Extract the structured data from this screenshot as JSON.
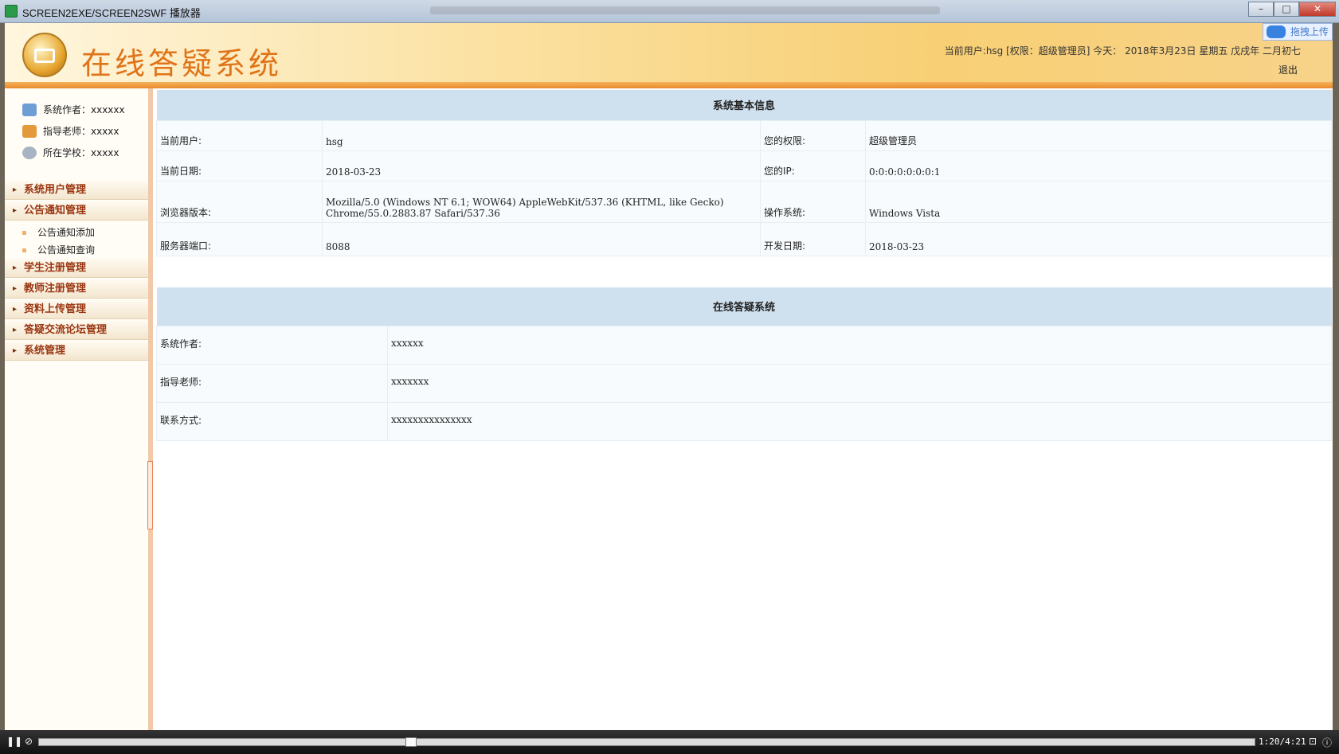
{
  "window": {
    "title": "SCREEN2EXE/SCREEN2SWF 播放器",
    "min": "–",
    "max": "□",
    "close": "✕"
  },
  "header": {
    "site_title": "在线答疑系统",
    "user_info": "当前用户:hsg [权限：超级管理员] 今天： 2018年3月23日 星期五 戊戌年 二月初七",
    "logout": "退出",
    "upload": "拖拽上传"
  },
  "sidebar": {
    "info": [
      {
        "label": "系统作者：xxxxxx"
      },
      {
        "label": "指导老师：xxxxx"
      },
      {
        "label": "所在学校：xxxxx"
      }
    ],
    "menus": [
      {
        "label": "系统用户管理"
      },
      {
        "label": "公告通知管理"
      },
      {
        "label": "学生注册管理"
      },
      {
        "label": "教师注册管理"
      },
      {
        "label": "资料上传管理"
      },
      {
        "label": "答疑交流论坛管理"
      },
      {
        "label": "系统管理"
      }
    ],
    "sub_items": [
      {
        "label": "公告通知添加"
      },
      {
        "label": "公告通知查询"
      }
    ]
  },
  "sysinfo": {
    "title": "系统基本信息",
    "rows": [
      {
        "l1": "当前用户:",
        "v1": "hsg",
        "l2": "您的权限:",
        "v2": "超级管理员"
      },
      {
        "l1": "当前日期:",
        "v1": "2018-03-23",
        "l2": "您的IP:",
        "v2": "0:0:0:0:0:0:0:1"
      },
      {
        "l1": "浏览器版本:",
        "v1a": "Mozilla/5.0 (Windows NT 6.1; WOW64) AppleWebKit/537.36 (KHTML, like Gecko)",
        "v1b": "Chrome/55.0.2883.87 Safari/537.36",
        "l2": "操作系统:",
        "v2": "Windows Vista"
      },
      {
        "l1": "服务器端口:",
        "v1": "8088",
        "l2": "开发日期:",
        "v2": "2018-03-23"
      }
    ]
  },
  "about": {
    "title": "在线答疑系统",
    "rows": [
      {
        "label": "系统作者:",
        "value": "xxxxxx"
      },
      {
        "label": "指导老师:",
        "value": "xxxxxxx"
      },
      {
        "label": "联系方式:",
        "value": "xxxxxxxxxxxxxxx"
      }
    ]
  },
  "player": {
    "time": "1:20/4:21",
    "pause": "❚❚",
    "menu": "⊘",
    "fit": "⊡",
    "info": "ⓘ"
  }
}
